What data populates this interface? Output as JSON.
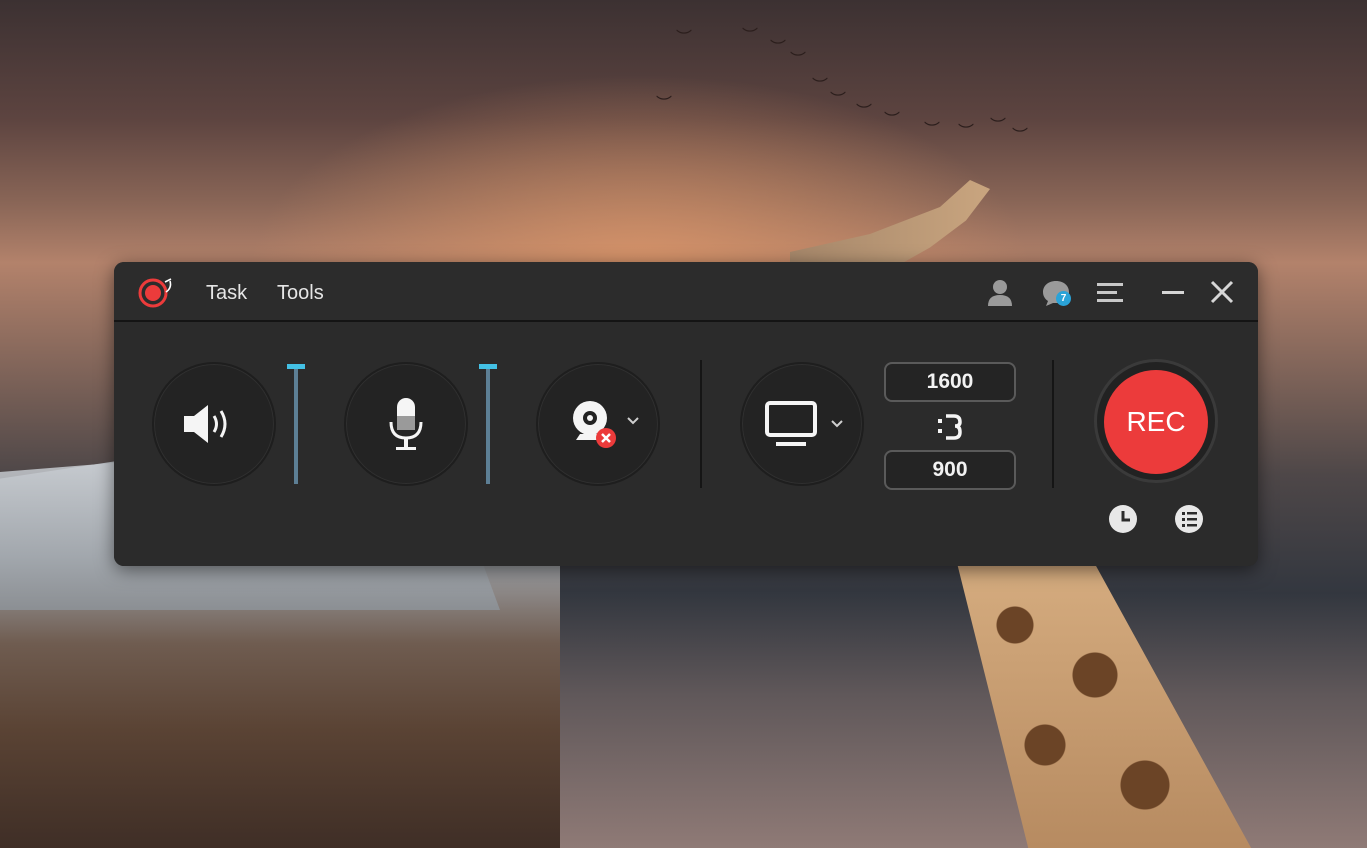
{
  "app": {
    "menu": {
      "task": "Task",
      "tools": "Tools"
    },
    "notifications_count": "7",
    "width_value": "1600",
    "height_value": "900",
    "rec_label": "REC"
  },
  "colors": {
    "accent_red": "#ec3b3b",
    "slider_handle": "#43c0e4",
    "badge_blue": "#2aa3d8",
    "window_bg": "#2b2b2b"
  },
  "icons": {
    "logo": "record-logo-icon",
    "account": "user-icon",
    "notifications": "chat-bubble-icon",
    "menu": "hamburger-menu-icon",
    "minimize": "minimize-icon",
    "close": "close-icon",
    "system_sound": "speaker-icon",
    "microphone": "microphone-icon",
    "webcam": "webcam-off-icon",
    "display": "monitor-icon",
    "aspect_lock": "link-icon",
    "schedule": "clock-icon",
    "task_list": "checklist-icon"
  }
}
